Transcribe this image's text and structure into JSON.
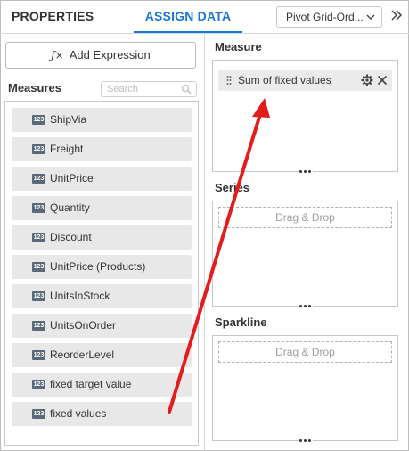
{
  "header": {
    "tab_properties": "PROPERTIES",
    "tab_assign_data": "ASSIGN DATA",
    "widget_dropdown_value": "Pivot Grid-Ord...",
    "accent_color": "#1976d2"
  },
  "left": {
    "add_expression_label": "Add Expression",
    "measures_title": "Measures",
    "search_placeholder": "Search",
    "type_badge": "123",
    "fields": [
      {
        "label": "ShipVia"
      },
      {
        "label": "Freight"
      },
      {
        "label": "UnitPrice"
      },
      {
        "label": "Quantity"
      },
      {
        "label": "Discount"
      },
      {
        "label": "UnitPrice (Products)"
      },
      {
        "label": "UnitsInStock"
      },
      {
        "label": "UnitsOnOrder"
      },
      {
        "label": "ReorderLevel"
      },
      {
        "label": "fixed target value"
      },
      {
        "label": "fixed values"
      }
    ]
  },
  "right": {
    "measure_title": "Measure",
    "measure_item": "Sum of fixed values",
    "series_title": "Series",
    "series_placeholder": "Drag & Drop",
    "sparkline_title": "Sparkline",
    "sparkline_placeholder": "Drag & Drop"
  },
  "annotation": {
    "arrow_color": "#e31c1c"
  }
}
